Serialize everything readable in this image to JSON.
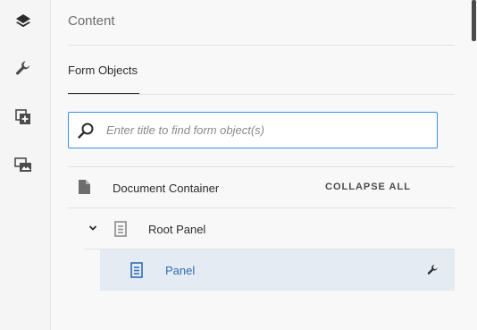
{
  "rail": {
    "items": [
      {
        "name": "layers",
        "icon": "layers-icon"
      },
      {
        "name": "properties",
        "icon": "wrench-icon"
      },
      {
        "name": "add-component",
        "icon": "add-box-icon"
      },
      {
        "name": "assets",
        "icon": "media-icon"
      }
    ]
  },
  "panel": {
    "title": "Content",
    "tab_label": "Form Objects",
    "search": {
      "placeholder": "Enter title to find form object(s)",
      "value": ""
    },
    "collapse_all": "COLLAPSE ALL",
    "tree": {
      "document_container": "Document Container",
      "root_panel": "Root Panel",
      "panel": "Panel"
    }
  },
  "colors": {
    "accent_blue": "#378ef0",
    "selected_bg": "#e5ebf3",
    "selected_text": "#2d6cb5"
  }
}
